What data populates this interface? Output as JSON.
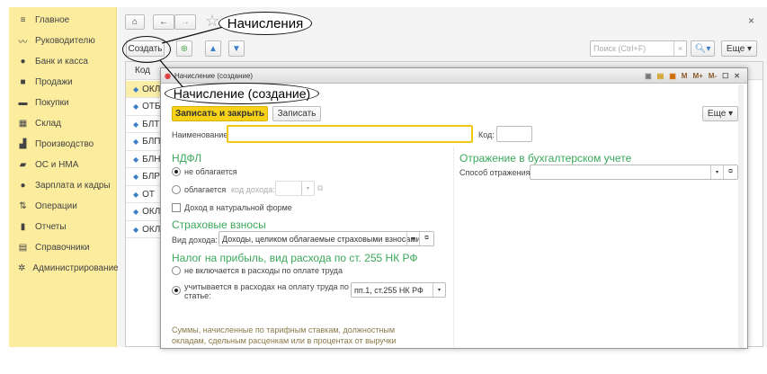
{
  "sidebar": {
    "items": [
      {
        "label": "Главное",
        "icon": "menu-icon"
      },
      {
        "label": "Руководителю",
        "icon": "trend-icon"
      },
      {
        "label": "Банк и касса",
        "icon": "ruble-coin-icon"
      },
      {
        "label": "Продажи",
        "icon": "bag-icon"
      },
      {
        "label": "Покупки",
        "icon": "cart-icon"
      },
      {
        "label": "Склад",
        "icon": "warehouse-icon"
      },
      {
        "label": "Производство",
        "icon": "factory-icon"
      },
      {
        "label": "ОС и НМА",
        "icon": "truck-icon"
      },
      {
        "label": "Зарплата и кадры",
        "icon": "person-icon"
      },
      {
        "label": "Операции",
        "icon": "operations-icon"
      },
      {
        "label": "Отчеты",
        "icon": "chart-icon"
      },
      {
        "label": "Справочники",
        "icon": "book-icon"
      },
      {
        "label": "Администрирование",
        "icon": "gear-icon"
      }
    ]
  },
  "toolbar": {
    "create": "Создать",
    "search_placeholder": "Поиск (Ctrl+F)",
    "more": "Еще",
    "close": "×"
  },
  "list": {
    "column": "Код",
    "rows": [
      "ОКЛ",
      "ОТБ",
      "БЛТ",
      "БЛП",
      "БЛН",
      "БЛР",
      "ОТ",
      "ОКЛ",
      "ОКЛ"
    ]
  },
  "annotations": {
    "list_title": "Начисления",
    "form_title": "Начисление (создание)"
  },
  "dialog": {
    "window_title": "Начисление (создание)",
    "title_buttons": [
      "M",
      "M+",
      "M-"
    ],
    "save_close": "Записать и закрыть",
    "save": "Записать",
    "more": "Еще",
    "name_label": "Наименование:",
    "name_value": "",
    "code_label": "Код:",
    "code_value": "",
    "ndfl": {
      "heading": "НДФЛ",
      "opt1": "не облагается",
      "opt2": "облагается",
      "code_label": "код дохода:",
      "natural": "Доход в натуральной форме",
      "selected": "не облагается"
    },
    "insurance": {
      "heading": "Страховые взносы",
      "label": "Вид дохода:",
      "value": "Доходы, целиком облагаемые страховыми взносами"
    },
    "tax": {
      "heading": "Налог на прибыль, вид расхода по ст. 255 НК РФ",
      "opt1": "не включается в расходы по оплате труда",
      "opt2": "учитывается в расходах на оплату труда по статье:",
      "value": "пп.1, ст.255 НК РФ",
      "selected": "opt2"
    },
    "note": "Суммы, начисленные по тарифным ставкам, должностным окладам, сдельным расценкам или в процентах от выручки в соответствии с принятыми формами и системами оплаты труда",
    "accounting": {
      "heading": "Отражение в бухгалтерском учете",
      "label": "Способ отражения:",
      "value": ""
    }
  }
}
